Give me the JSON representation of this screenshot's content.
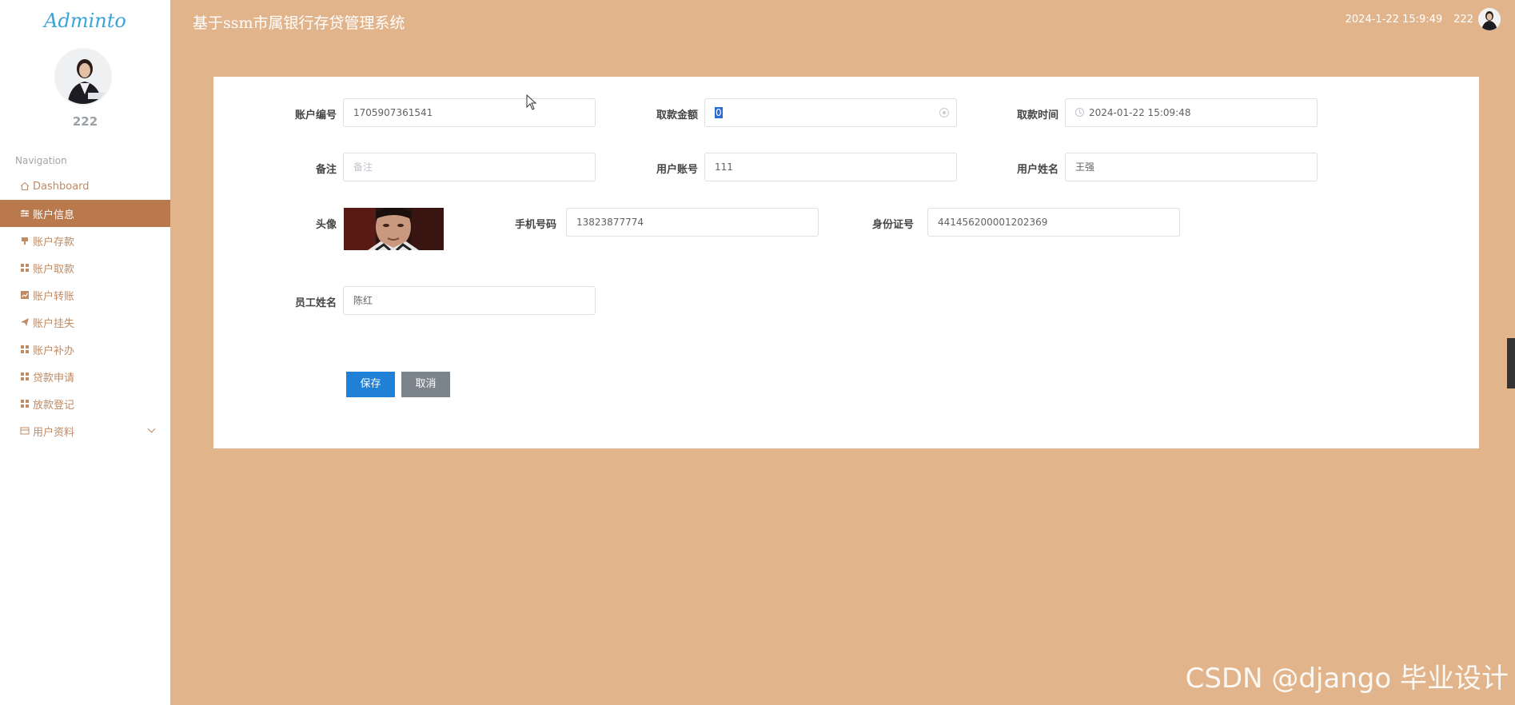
{
  "sidebar": {
    "logo": "Adminto",
    "user_name": "222",
    "nav_title": "Navigation",
    "items": [
      {
        "label": "Dashboard",
        "icon": "home-icon"
      },
      {
        "label": "账户信息",
        "icon": "sliders-icon"
      },
      {
        "label": "账户存款",
        "icon": "deposit-icon"
      },
      {
        "label": "账户取款",
        "icon": "grid-icon"
      },
      {
        "label": "账户转账",
        "icon": "chart-icon"
      },
      {
        "label": "账户挂失",
        "icon": "send-icon"
      },
      {
        "label": "账户补办",
        "icon": "grid-icon"
      },
      {
        "label": "贷款申请",
        "icon": "grid-icon"
      },
      {
        "label": "放款登记",
        "icon": "grid-icon"
      },
      {
        "label": "用户资料",
        "icon": "card-icon"
      }
    ],
    "active_label": "账户信息"
  },
  "header": {
    "title": "基于ssm市属银行存贷管理系统",
    "datetime": "2024-1-22 15:9:49",
    "user": "222"
  },
  "form": {
    "account_no_label": "账户编号",
    "account_no": "1705907361541",
    "amount_label": "取款金额",
    "amount": "0",
    "time_label": "取款时间",
    "time": "2024-01-22 15:09:48",
    "remark_label": "备注",
    "remark_placeholder": "备注",
    "user_account_label": "用户账号",
    "user_account": "111",
    "user_name_label": "用户姓名",
    "user_name": "王强",
    "avatar_label": "头像",
    "phone_label": "手机号码",
    "phone": "13823877774",
    "id_card_label": "身份证号",
    "id_card": "441456200001202369",
    "staff_name_label": "员工姓名",
    "staff_name": "陈红",
    "save_label": "保存",
    "cancel_label": "取消"
  },
  "watermark": "CSDN @django 毕业设计",
  "colors": {
    "background": "#e1b48c",
    "sidebar_active": "#b9794c",
    "save_button": "#2080d6",
    "cancel_button": "#7b838b"
  }
}
